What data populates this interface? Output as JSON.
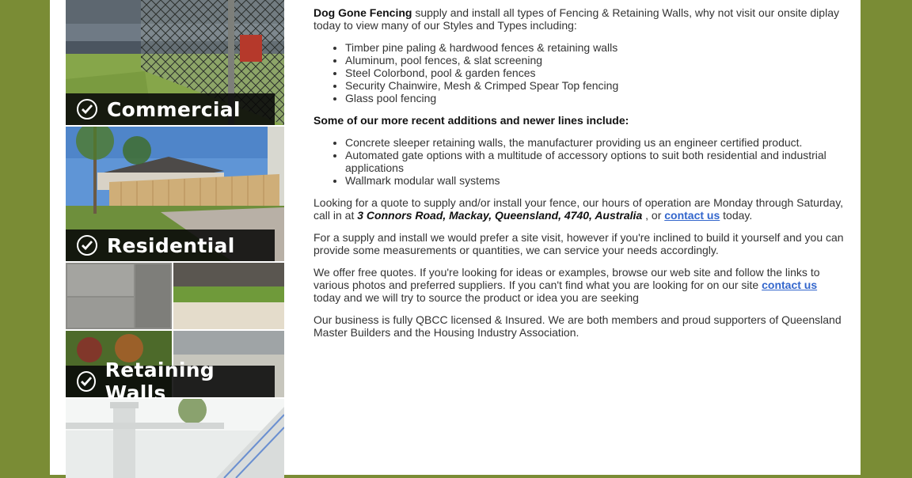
{
  "sidebar": {
    "tiles": [
      {
        "label": "Commercial"
      },
      {
        "label": "Residential"
      },
      {
        "label": "Retaining Walls"
      }
    ]
  },
  "content": {
    "intro_brand": "Dog Gone Fencing",
    "intro_text": " supply and install all types of Fencing & Retaining Walls, why not visit our onsite diplay today to view many of our Styles and Types including:",
    "list1": [
      "Timber pine paling & hardwood fences & retaining walls",
      "Aluminum, pool fences,  & slat screening",
      "Steel Colorbond, pool & garden fences",
      "Security Chainwire, Mesh & Crimped Spear Top fencing",
      "Glass pool fencing"
    ],
    "additions_heading": "Some of our more recent additions and newer lines include:",
    "list2": [
      "Concrete sleeper retaining walls, the manufacturer providing us an engineer certified product.",
      "Automated gate options with a multitude of accessory options to suit both residential and industrial applications",
      "Wallmark modular wall systems"
    ],
    "quote_text_before": "Looking for a quote to supply and/or  install your fence, our hours of operation are Monday through Saturday,  call in at ",
    "address": "3 Connors Road, Mackay, Queensland, 4740, Australia",
    "quote_text_mid": " , or ",
    "contact_link_1": "contact us",
    "quote_text_after": " today.",
    "site_visit_text": "For a supply and install we would prefer a site visit, however if you're inclined to build it yourself and you can provide some measurements or quantities, we can service your needs accordingly.",
    "free_quotes_before": "We offer free quotes.  If you're looking for ideas or examples, browse our web site and follow the links to various photos and preferred suppliers. If you can't find what you are looking for on our site ",
    "contact_link_2": "contact us",
    "free_quotes_after": " today and we will try to source the product or idea you are seeking",
    "licensed_text": "Our business is fully QBCC licensed & Insured.  We are both members and proud supporters of Queensland Master Builders and the Housing Industry Association."
  },
  "colors": {
    "background_olive": "#7a8c35",
    "link_blue": "#3366cc",
    "label_bg": "#080808"
  },
  "icons": [
    "check-circle-icon"
  ]
}
